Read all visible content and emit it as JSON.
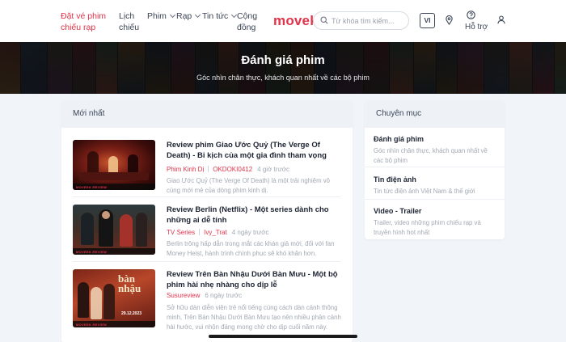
{
  "header": {
    "nav": [
      {
        "label": "Đặt vé phim chiếu rạp",
        "active": true
      },
      {
        "label": "Lịch chiếu"
      },
      {
        "label": "Phim"
      },
      {
        "label": "Rạp"
      },
      {
        "label": "Tin tức"
      },
      {
        "label": "Cộng đồng"
      }
    ],
    "logo": "movek",
    "search_placeholder": "Từ khóa tìm kiếm...",
    "lang": "VI",
    "help_label": "Hỗ trợ",
    "icons": [
      "search-icon",
      "location-pin-icon",
      "help-circle-icon",
      "user-icon"
    ]
  },
  "banner": {
    "title": "Đánh giá phim",
    "subtitle": "Góc nhìn chân thực, khách quan nhất về các bộ phim"
  },
  "main": {
    "heading": "Mới nhất",
    "articles": [
      {
        "title": "Review phim Giao Ước Quỷ (The Verge Of Death) - Bi kịch của một gia đình tham vọng",
        "category": "Phim Kinh Dị",
        "author": "OKDOKI0412",
        "time": "4 giờ trước",
        "desc": "Giao Ước Quỷ (The Verge Of Death) là một trải nghiệm vô cùng mới mẻ của dòng phim kinh dị."
      },
      {
        "title": "Review Berlin (Netflix) - Một series dành cho những ai dễ tính",
        "category": "TV Series",
        "author": "Ivy_Trat",
        "time": "4 ngày trước",
        "desc": "Berlin trông hấp dẫn trong mắt các khán giả mới, đối với fan Money Heist, hành trình chính phục sẽ khó khăn hơn."
      },
      {
        "title": "Review Trên Bàn Nhậu Dưới Bàn Mưu - Một bộ phim hài nhẹ nhàng cho dịp lễ",
        "category": "Susureview",
        "author": "",
        "time": "6 ngày trước",
        "desc": "Sở hữu dàn diễn viên trẻ nổi tiếng cùng cách dàn cảnh thông minh, Trên Bàn Nhậu Dưới Bàn Mưu tạo nên nhiều phân cảnh hài hước, vui nhộn đáng mong chờ cho dịp cuối năm này."
      }
    ],
    "thumb_tag": "MOVEEK REVIEW",
    "thumb3_text": "bàn nhậu",
    "thumb3_date": "29.12.2023"
  },
  "sidebar": {
    "heading": "Chuyên mục",
    "categories": [
      {
        "name": "Đánh giá phim",
        "desc": "Góc nhìn chân thực, khách quan nhất về các bộ phim"
      },
      {
        "name": "Tin điện ảnh",
        "desc": "Tin tức điện ảnh Việt Nam & thế giới"
      },
      {
        "name": "Video - Trailer",
        "desc": "Trailer, video những phim chiếu rạp và truyền hình hot nhất"
      }
    ]
  },
  "colors": {
    "accent": "#e2334a",
    "card_head_bg": "#eef2f7",
    "page_bg": "#f1f4f8"
  }
}
